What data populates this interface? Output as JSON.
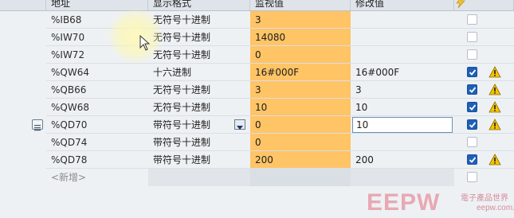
{
  "columns": {
    "address": "地址",
    "display_format": "显示格式",
    "monitor_value": "监视值",
    "modify_value": "修改值"
  },
  "rows": [
    {
      "address": "%IB68",
      "format": "无符号十进制",
      "monitor": "3",
      "modify": "",
      "checked": false,
      "warning": false
    },
    {
      "address": "%IW70",
      "format": "无符号十进制",
      "monitor": "14080",
      "modify": "",
      "checked": false,
      "warning": false
    },
    {
      "address": "%IW72",
      "format": "无符号十进制",
      "monitor": "0",
      "modify": "",
      "checked": false,
      "warning": false
    },
    {
      "address": "%QW64",
      "format": "十六进制",
      "monitor": "16#000F",
      "modify": "16#000F",
      "checked": true,
      "warning": true
    },
    {
      "address": "%QB66",
      "format": "无符号十进制",
      "monitor": "3",
      "modify": "3",
      "checked": true,
      "warning": true
    },
    {
      "address": "%QW68",
      "format": "无符号十进制",
      "monitor": "10",
      "modify": "10",
      "checked": true,
      "warning": true
    },
    {
      "address": "%QD70",
      "format": "带符号十进制",
      "monitor": "0",
      "modify": "10",
      "checked": true,
      "warning": true
    },
    {
      "address": "%QD74",
      "format": "带符号十进制",
      "monitor": "0",
      "modify": "",
      "checked": false,
      "warning": false
    },
    {
      "address": "%QD78",
      "format": "带符号十进制",
      "monitor": "200",
      "modify": "200",
      "checked": true,
      "warning": true
    }
  ],
  "new_row": {
    "address": "<新增>"
  },
  "watermark": {
    "logo": "EEPW",
    "tagline": "電子產品世界",
    "url": "eepw.com.cn"
  },
  "icons": {
    "header_modify": "lightning-icon",
    "warning": "warning-triangle-icon",
    "dropdown": "dropdown-arrow-icon",
    "row_marker": "row-edit-icon"
  },
  "colors": {
    "monitor_bg": "#ffc466",
    "checkbox_on": "#1e5fb8",
    "warning": "#f5c400"
  }
}
